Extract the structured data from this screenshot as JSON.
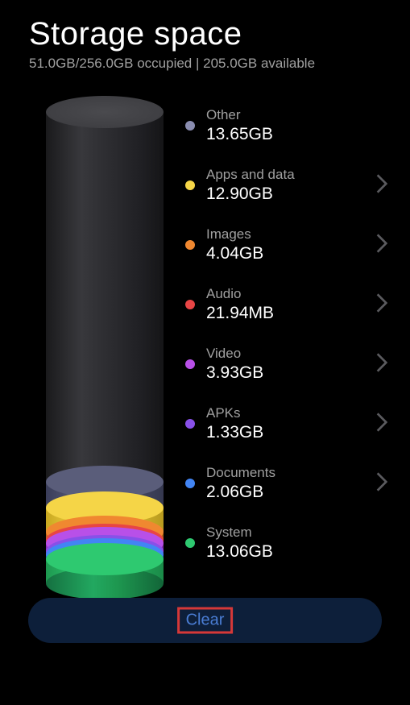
{
  "header": {
    "title": "Storage space",
    "subtitle": "51.0GB/256.0GB occupied | 205.0GB available"
  },
  "categories": [
    {
      "label": "Other",
      "size": "13.65GB",
      "color": "#8a8db0",
      "navigable": false
    },
    {
      "label": "Apps and data",
      "size": "12.90GB",
      "color": "#f5d547",
      "navigable": true
    },
    {
      "label": "Images",
      "size": "4.04GB",
      "color": "#f08830",
      "navigable": true
    },
    {
      "label": "Audio",
      "size": "21.94MB",
      "color": "#e84545",
      "navigable": true
    },
    {
      "label": "Video",
      "size": "3.93GB",
      "color": "#b850e8",
      "navigable": true
    },
    {
      "label": "APKs",
      "size": "1.33GB",
      "color": "#8850e8",
      "navigable": true
    },
    {
      "label": "Documents",
      "size": "2.06GB",
      "color": "#4285f4",
      "navigable": true
    },
    {
      "label": "System",
      "size": "13.06GB",
      "color": "#2ec970",
      "navigable": false
    }
  ],
  "footer": {
    "clear_label": "Clear"
  },
  "chart_data": {
    "type": "bar",
    "title": "Storage space",
    "categories": [
      "Other",
      "Apps and data",
      "Images",
      "Audio",
      "Video",
      "APKs",
      "Documents",
      "System"
    ],
    "values_gb": [
      13.65,
      12.9,
      4.04,
      0.02194,
      3.93,
      1.33,
      2.06,
      13.06
    ],
    "total_gb": 256.0,
    "used_gb": 51.0,
    "available_gb": 205.0,
    "ylabel": "GB",
    "ylim": [
      0,
      256
    ]
  }
}
